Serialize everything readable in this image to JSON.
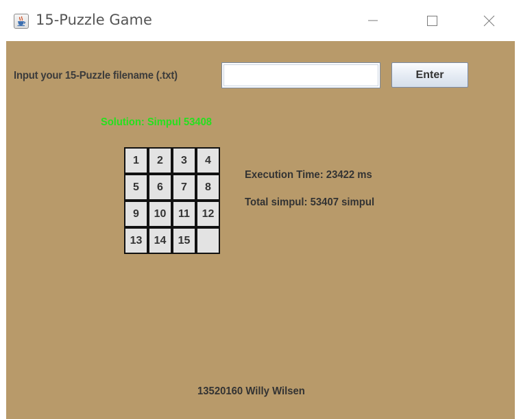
{
  "window": {
    "title": "15-Puzzle Game",
    "icon": "java-cup-icon",
    "controls": [
      "minimize-icon",
      "maximize-icon",
      "close-icon"
    ]
  },
  "form": {
    "prompt_label": "Input your 15-Puzzle filename (.txt)",
    "filename_value": "",
    "filename_placeholder": "",
    "enter_label": "Enter"
  },
  "result": {
    "solution_text": "Solution: Simpul 53408",
    "execution_time": "Execution Time: 23422 ms",
    "total_simpul": "Total simpul: 53407 simpul"
  },
  "board": {
    "tiles": [
      [
        "1",
        "2",
        "3",
        "4"
      ],
      [
        "5",
        "6",
        "7",
        "8"
      ],
      [
        "9",
        "10",
        "11",
        "12"
      ],
      [
        "13",
        "14",
        "15",
        ""
      ]
    ]
  },
  "footer": {
    "author": "13520160 Willy Wilsen"
  },
  "colors": {
    "panel_background": "#b89a6a",
    "solution_text": "#26e01e",
    "tile_background": "#e3e3e3",
    "tile_border": "#111111"
  }
}
